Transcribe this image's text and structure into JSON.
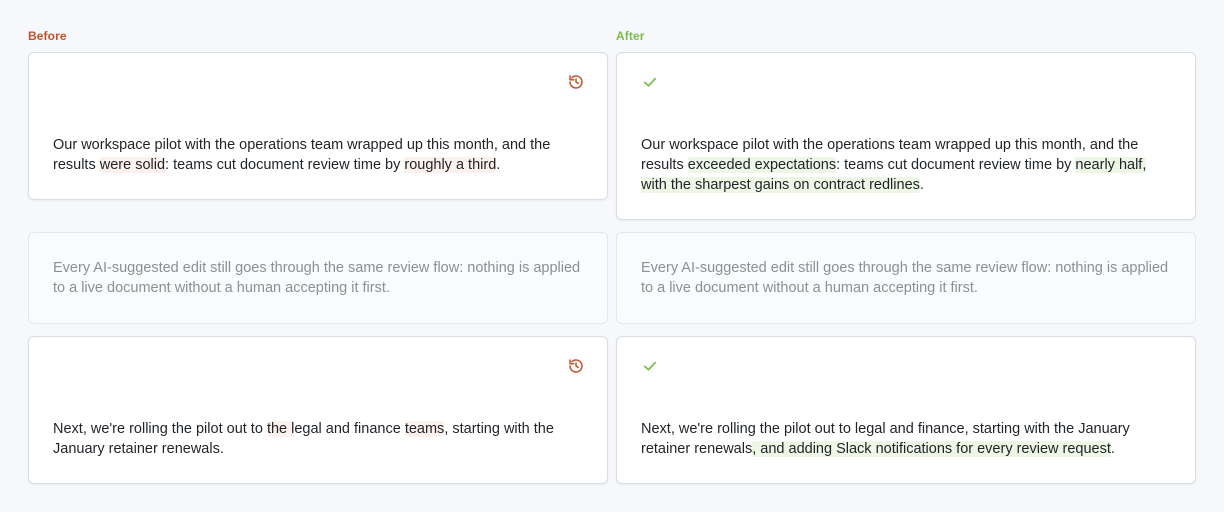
{
  "labels": {
    "before": "Before",
    "after": "After"
  },
  "colors": {
    "before_accent": "#c0532b",
    "after_accent": "#7dbb4a"
  },
  "icons": {
    "revert": "history-icon",
    "accepted": "check-icon"
  },
  "rows": [
    {
      "before": {
        "p1": "Our workspace pilot with the operations team wrapped up this month, and the results ",
        "d1": "were solid",
        "p2": ": teams cut document review time by ",
        "d2": "roughly a third",
        "p3": "."
      },
      "after": {
        "p1": "Our workspace pilot with the operations team wrapped up this month, and the results ",
        "a1": "exceeded expectations",
        "p2": ": teams cut document review time by ",
        "a2": "nearly half, with the sharpest gains on contract redlines",
        "p3": "."
      }
    },
    {
      "unchanged": "Every AI-suggested edit still goes through the same review flow: nothing is applied to a live document without a human accepting it first."
    },
    {
      "before": {
        "p1": "Next, we're rolling the pilot out to ",
        "d1": "the l",
        "p2": "egal and finance ",
        "d2": "teams",
        "p3": ", starting with the January retainer renewals."
      },
      "after": {
        "p1": "Next, we're rolling the pilot out to legal and finance, starting with the January retainer renewals",
        "a1": ", and adding Slack notifications for every review request",
        "p2": "."
      }
    }
  ]
}
